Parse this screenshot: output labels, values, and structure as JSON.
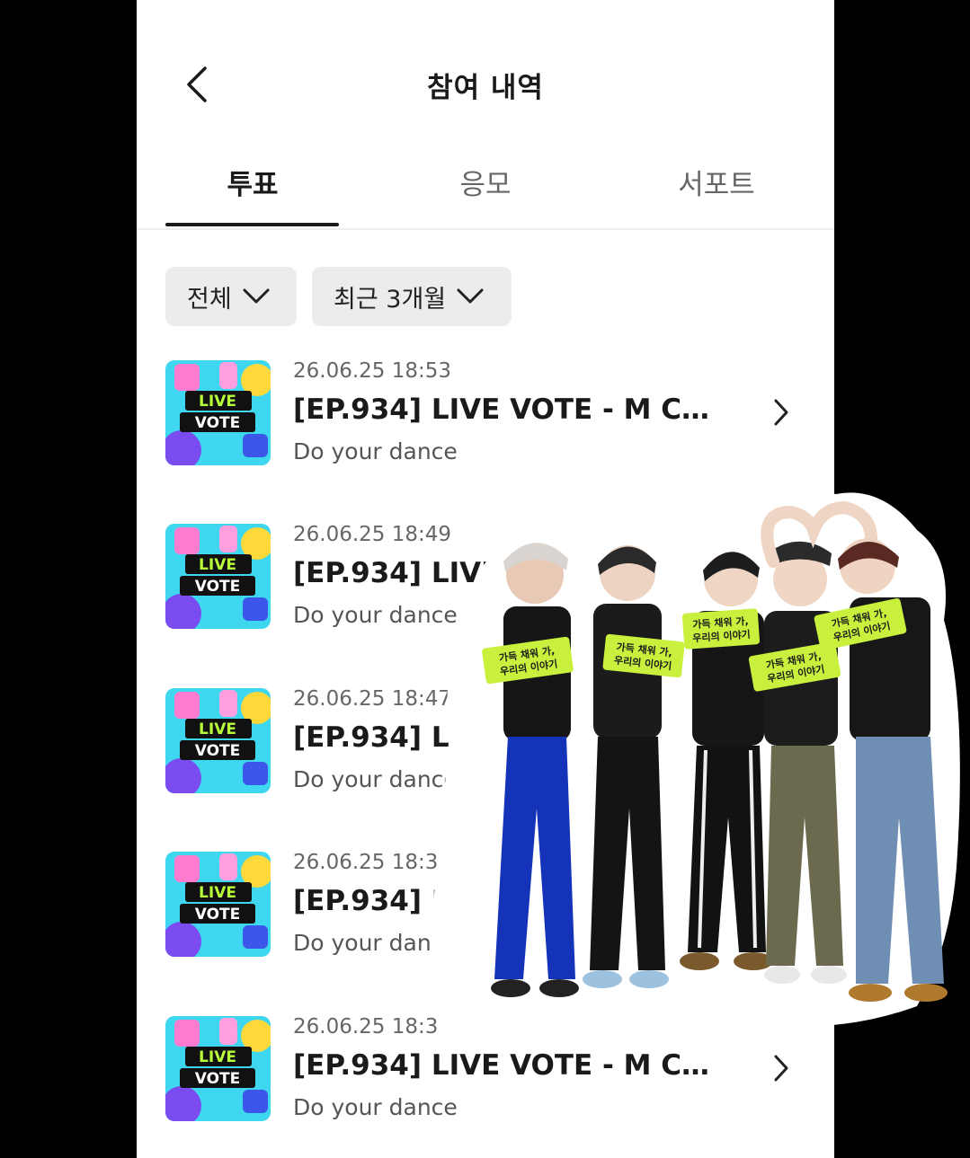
{
  "header": {
    "title": "참여 내역",
    "back_icon": "chevron-left-icon"
  },
  "tabs": [
    {
      "label": "투표",
      "active": true
    },
    {
      "label": "응모",
      "active": false
    },
    {
      "label": "서포트",
      "active": false
    }
  ],
  "filters": [
    {
      "label": "전체",
      "icon": "chevron-down-icon"
    },
    {
      "label": "최근 3개월",
      "icon": "chevron-down-icon"
    }
  ],
  "list": {
    "items": [
      {
        "date": "26.06.25 18:53",
        "title": "[EP.934] LIVE VOTE - M COU...",
        "subtitle": "Do your dance",
        "thumbnail": "live-vote-thumbnail"
      },
      {
        "date": "26.06.25 18:49",
        "title": "[EP.934] LIVE VOTE - M COU...",
        "subtitle": "Do your dance",
        "thumbnail": "live-vote-thumbnail"
      },
      {
        "date": "26.06.25 18:47",
        "title": "[EP.934] LIVE VOTE - M COU...",
        "subtitle": "Do your dance",
        "thumbnail": "live-vote-thumbnail"
      },
      {
        "date": "26.06.25 18:32",
        "title": "[EP.934] LIVE VOTE - M COU...",
        "subtitle": "Do your dance",
        "thumbnail": "live-vote-thumbnail"
      },
      {
        "date": "26.06.25 18:3",
        "title": "[EP.934] LIVE VOTE - M COU...",
        "subtitle": "Do your dance",
        "thumbnail": "live-vote-thumbnail"
      }
    ]
  },
  "thumbnail_text": {
    "line1": "LIVE",
    "line2": "VOTE"
  },
  "sticker": {
    "description_icon": "group-photo-sticker",
    "sign_line1": "가득 채워 가,",
    "sign_line2": "우리의 이야기"
  },
  "colors": {
    "background": "#000000",
    "screen": "#ffffff",
    "chip": "#ececee",
    "sign": "#c8f03c",
    "text_primary": "#1a1a1a",
    "text_secondary": "#666666"
  }
}
